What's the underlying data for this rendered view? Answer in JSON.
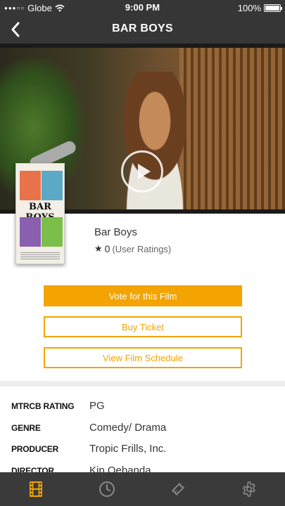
{
  "status_bar": {
    "signal_dots": "●●●○○",
    "carrier": "Globe",
    "time": "9:00 PM",
    "battery_text": "100%",
    "battery_level": 1.0
  },
  "nav": {
    "title": "BAR BOYS",
    "back_icon": "chevron-left-icon"
  },
  "hero": {
    "play_icon": "play-icon"
  },
  "film": {
    "poster_title": "BAR BOYS",
    "name": "Bar Boys",
    "rating_icon": "star-icon",
    "rating_value": "0",
    "rating_label": "(User Ratings)"
  },
  "actions": {
    "vote_label": "Vote for this Film",
    "buy_label": "Buy Ticket",
    "schedule_label": "View Film Schedule"
  },
  "details": [
    {
      "label": "MTRCB RATING",
      "value": "PG"
    },
    {
      "label": "GENRE",
      "value": "Comedy/ Drama"
    },
    {
      "label": "PRODUCER",
      "value": "Tropic Frills, Inc."
    },
    {
      "label": "DIRECTOR",
      "value": "Kip Oebanda"
    }
  ],
  "tabs": [
    {
      "icon": "film-icon",
      "active": true
    },
    {
      "icon": "clock-icon",
      "active": false
    },
    {
      "icon": "ticket-icon",
      "active": false
    },
    {
      "icon": "gear-icon",
      "active": false
    }
  ],
  "colors": {
    "accent": "#f3a400",
    "bar": "#363636",
    "tab_bar": "#3a3a3a",
    "tab_inactive": "#8a8a8a"
  }
}
